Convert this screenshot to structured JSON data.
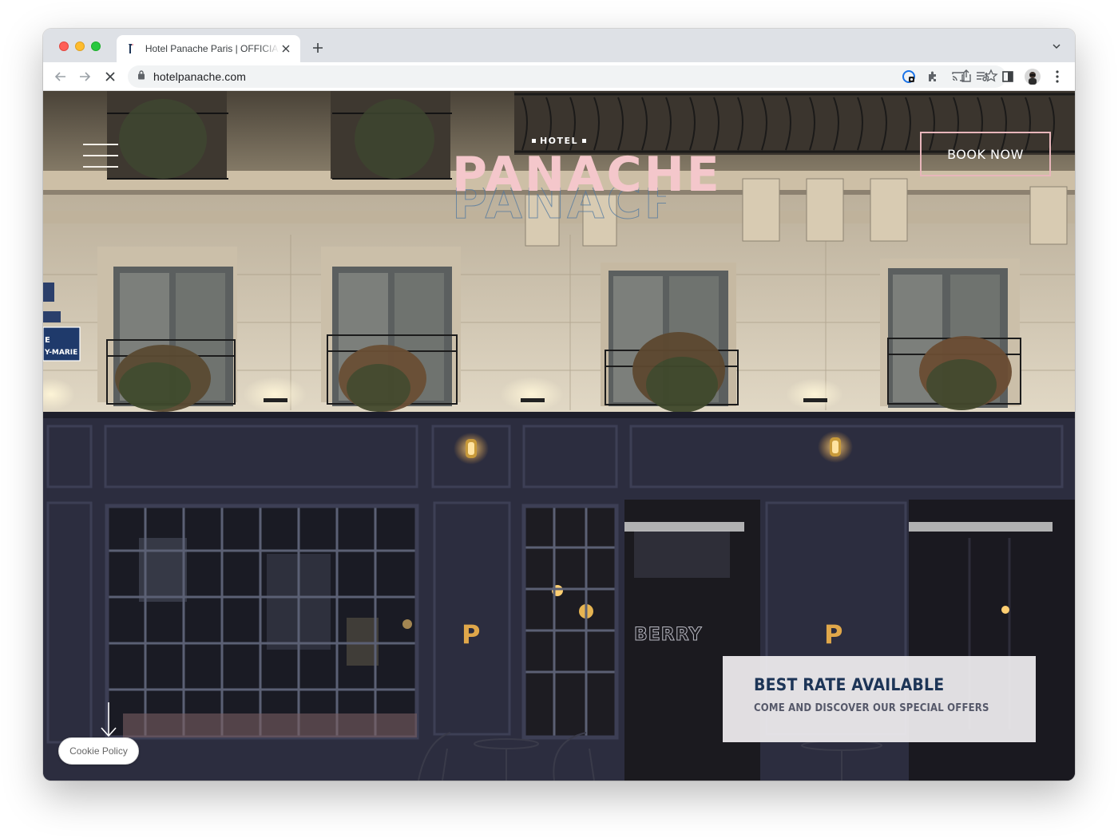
{
  "browser": {
    "tab_title": "Hotel Panache Paris | OFFICIAL SITE",
    "url": "hotelpanache.com"
  },
  "site": {
    "logo_small": "HOTEL",
    "logo_main": "PANACHE",
    "book_now_label": "BOOK NOW",
    "facade_letter": "P",
    "cafe_sign": "BERRY",
    "street_sign": "E\nY-MARIE",
    "offer": {
      "title": "BEST RATE AVAILABLE",
      "subtitle": "COME AND DISCOVER OUR SPECIAL OFFERS"
    },
    "cookie_label": "Cookie Policy"
  },
  "colors": {
    "logo_pink": "#f4c7cb",
    "book_border": "#e8b6bb",
    "offer_title": "#1d3557",
    "facade_navy": "#2b2c3d",
    "stone": "#d9cdb8"
  },
  "icons": [
    "back-arrow-icon",
    "forward-arrow-icon",
    "stop-loading-icon",
    "lock-icon",
    "share-icon",
    "star-icon",
    "extension-icon",
    "puzzle-icon",
    "cast-icon",
    "reading-list-icon",
    "side-panel-icon",
    "profile-avatar",
    "kebab-menu-icon",
    "hamburger-menu-icon",
    "scroll-down-arrow-icon"
  ]
}
